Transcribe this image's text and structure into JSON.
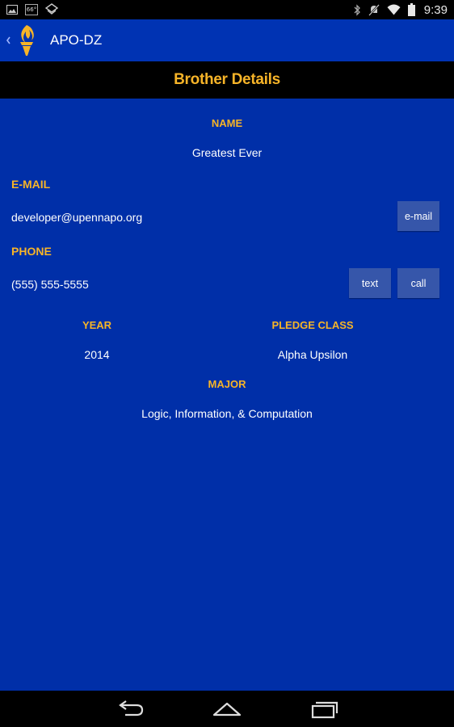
{
  "status_bar": {
    "temp_badge": "66°",
    "time": "9:39"
  },
  "action_bar": {
    "title": "APO-DZ",
    "back_icon": "chevron-left-icon",
    "logo_icon": "torch-logo"
  },
  "header": {
    "title": "Brother Details"
  },
  "details": {
    "name_label": "NAME",
    "name_value": "Greatest Ever",
    "email_label": "E-MAIL",
    "email_value": "developer@upennapo.org",
    "email_button": "e-mail",
    "phone_label": "PHONE",
    "phone_value": "(555) 555-5555",
    "text_button": "text",
    "call_button": "call",
    "year_label": "YEAR",
    "year_value": "2014",
    "pledge_label": "PLEDGE CLASS",
    "pledge_value": "Alpha Upsilon",
    "major_label": "MAJOR",
    "major_value": "Logic, Information, & Computation"
  },
  "colors": {
    "background": "#002fa8",
    "action_bar": "#0033b3",
    "accent": "#f7b428",
    "button": "#3656aa"
  },
  "nav_bar": {
    "back": "back-icon",
    "home": "home-icon",
    "recents": "recents-icon"
  }
}
